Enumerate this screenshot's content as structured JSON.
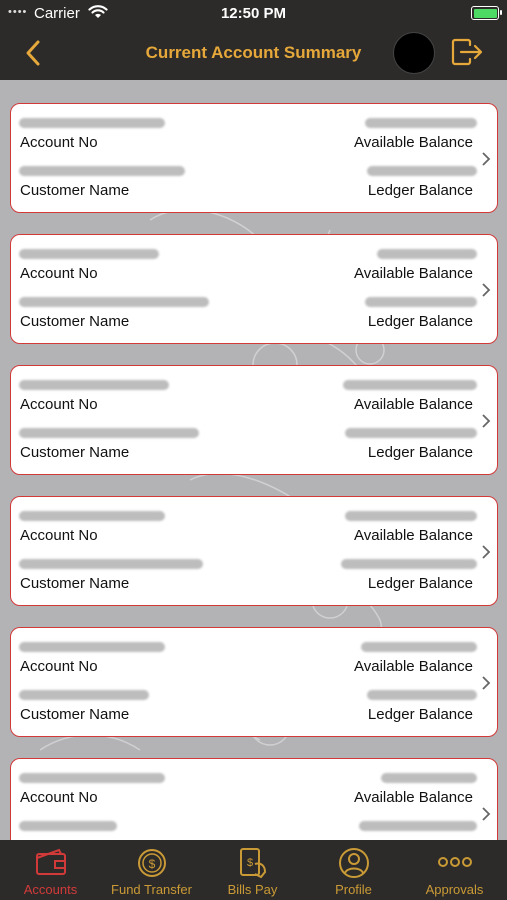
{
  "status": {
    "carrier": "Carrier",
    "time": "12:50 PM"
  },
  "nav": {
    "title": "Current Account Summary"
  },
  "labels": {
    "account_no": "Account No",
    "customer_name": "Customer Name",
    "available_balance": "Available Balance",
    "ledger_balance": "Ledger Balance"
  },
  "tabs": [
    {
      "label": "Accounts",
      "icon": "wallet-icon",
      "active": true
    },
    {
      "label": "Fund Transfer",
      "icon": "fund-transfer-icon",
      "active": false
    },
    {
      "label": "Bills Pay",
      "icon": "bills-pay-icon",
      "active": false
    },
    {
      "label": "Profile",
      "icon": "profile-icon",
      "active": false
    },
    {
      "label": "Approvals",
      "icon": "more-icon",
      "active": false
    }
  ],
  "colors": {
    "header_bg": "#2d2b29",
    "accent": "#e6a83a",
    "card_border": "#d23a3a",
    "content_bg": "#b3b3b6"
  }
}
